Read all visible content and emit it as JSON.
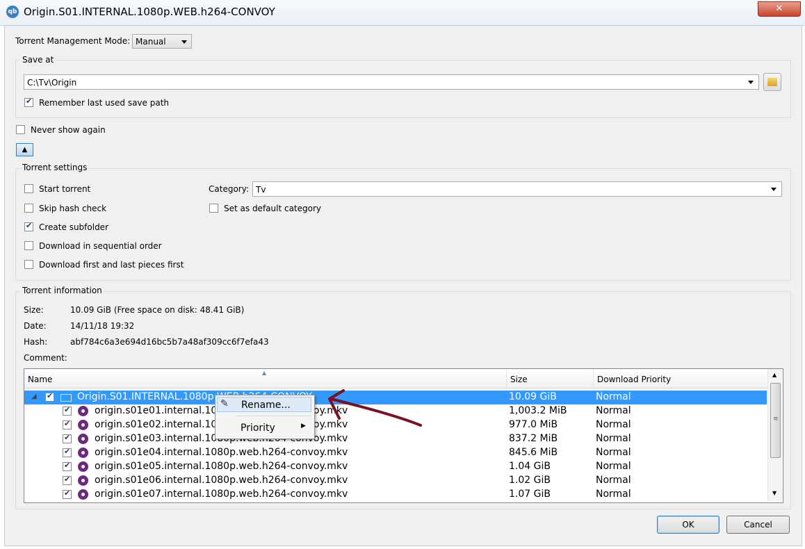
{
  "window": {
    "title": "Origin.S01.INTERNAL.1080p.WEB.h264-CONVOY",
    "app_icon_text": "qb",
    "close_symbol": "✕"
  },
  "management": {
    "label": "Torrent Management Mode:",
    "value": "Manual"
  },
  "save_at": {
    "group_title": "Save at",
    "path": "C:\\Tv\\Origin",
    "remember_label": "Remember last used save path",
    "remember_checked": true
  },
  "never_show": {
    "label": "Never show again",
    "checked": false
  },
  "collapse_symbol": "▲",
  "settings": {
    "group_title": "Torrent settings",
    "start_torrent": "Start torrent",
    "skip_hash": "Skip hash check",
    "create_subfolder": "Create subfolder",
    "sequential": "Download in sequential order",
    "first_last": "Download first and last pieces first",
    "category_label": "Category:",
    "category_value": "Tv",
    "default_category": "Set as default category"
  },
  "info": {
    "group_title": "Torrent information",
    "size_label": "Size:",
    "size_value": "10.09 GiB (Free space on disk: 48.41 GiB)",
    "date_label": "Date:",
    "date_value": "14/11/18 19:32",
    "hash_label": "Hash:",
    "hash_value": "abf784c6a3e694d16bc5b7a48af309cc6f7efa43",
    "comment_label": "Comment:"
  },
  "tree": {
    "columns": [
      "Name",
      "Size",
      "Download Priority"
    ],
    "root": {
      "name": "Origin.S01.INTERNAL.1080p.WEB.h264-CONVOY",
      "size": "10.09 GiB",
      "priority": "Normal"
    },
    "files": [
      {
        "name": "origin.s01e01.internal.1080p.web.h264-convoy.mkv",
        "size": "1,003.2 MiB",
        "priority": "Normal"
      },
      {
        "name": "origin.s01e02.internal.1080p.web.h264-convoy.mkv",
        "size": "977.0 MiB",
        "priority": "Normal"
      },
      {
        "name": "origin.s01e03.internal.1080p.web.h264-convoy.mkv",
        "size": "837.2 MiB",
        "priority": "Normal"
      },
      {
        "name": "origin.s01e04.internal.1080p.web.h264-convoy.mkv",
        "size": "845.6 MiB",
        "priority": "Normal"
      },
      {
        "name": "origin.s01e05.internal.1080p.web.h264-convoy.mkv",
        "size": "1.04 GiB",
        "priority": "Normal"
      },
      {
        "name": "origin.s01e06.internal.1080p.web.h264-convoy.mkv",
        "size": "1.02 GiB",
        "priority": "Normal"
      },
      {
        "name": "origin.s01e07.internal.1080p.web.h264-convoy.mkv",
        "size": "1.07 GiB",
        "priority": "Normal"
      }
    ]
  },
  "context_menu": {
    "rename": "Rename...",
    "priority": "Priority"
  },
  "buttons": {
    "ok": "OK",
    "cancel": "Cancel"
  },
  "colors": {
    "selection": "#3399ff",
    "annotation_arrow": "#7a1020"
  }
}
